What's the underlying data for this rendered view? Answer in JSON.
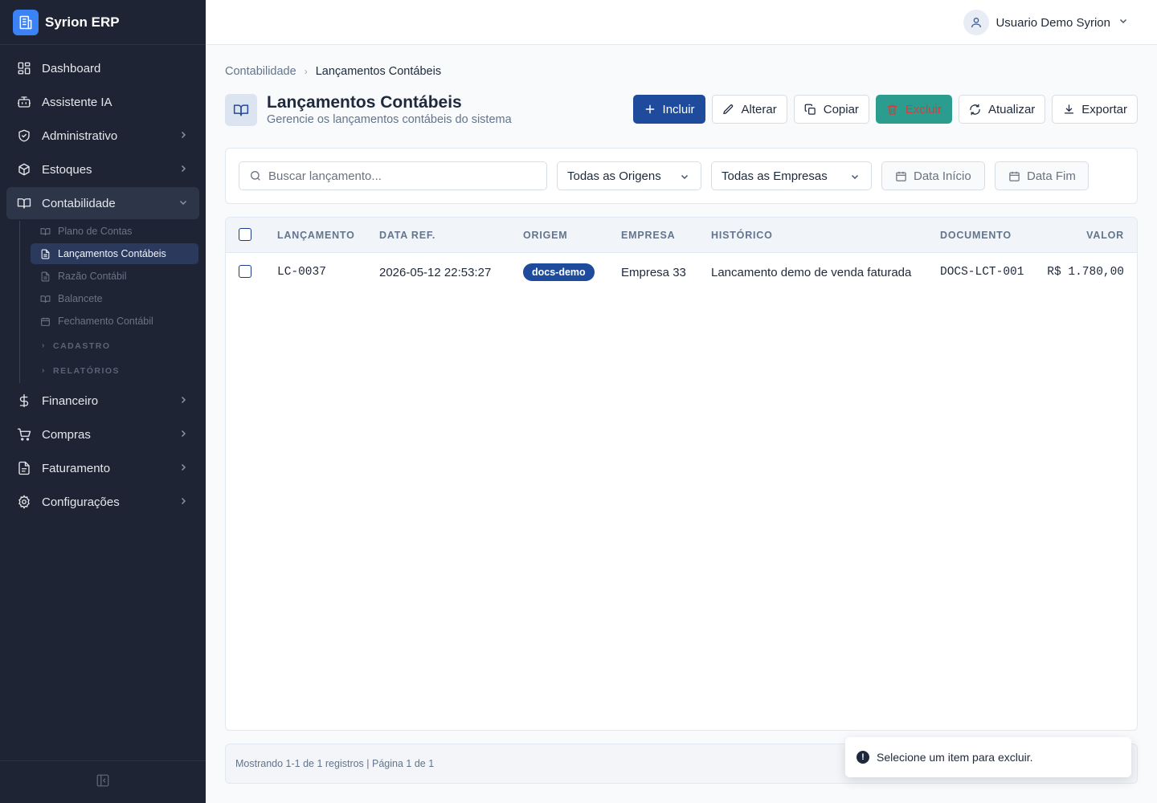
{
  "app": {
    "name": "Syrion ERP"
  },
  "sidebar": {
    "items": [
      {
        "label": "Dashboard"
      },
      {
        "label": "Assistente IA"
      },
      {
        "label": "Administrativo"
      },
      {
        "label": "Estoques"
      },
      {
        "label": "Contabilidade"
      },
      {
        "label": "Financeiro"
      },
      {
        "label": "Compras"
      },
      {
        "label": "Faturamento"
      },
      {
        "label": "Configurações"
      }
    ],
    "contabilidade_sub": [
      {
        "label": "Plano de Contas"
      },
      {
        "label": "Lançamentos Contábeis"
      },
      {
        "label": "Razão Contábil"
      },
      {
        "label": "Balancete"
      },
      {
        "label": "Fechamento Contábil"
      }
    ],
    "groups": [
      {
        "label": "CADASTRO"
      },
      {
        "label": "RELATÓRIOS"
      }
    ]
  },
  "topbar": {
    "user_name": "Usuario Demo Syrion"
  },
  "breadcrumb": {
    "parent": "Contabilidade",
    "current": "Lançamentos Contábeis"
  },
  "page": {
    "title": "Lançamentos Contábeis",
    "subtitle": "Gerencie os lançamentos contábeis do sistema"
  },
  "toolbar": {
    "incluir": "Incluir",
    "alterar": "Alterar",
    "copiar": "Copiar",
    "excluir": "Excluir",
    "atualizar": "Atualizar",
    "exportar": "Exportar"
  },
  "filters": {
    "search_placeholder": "Buscar lançamento...",
    "origem_selected": "Todas as Origens",
    "empresa_selected": "Todas as Empresas",
    "data_inicio": "Data Início",
    "data_fim": "Data Fim"
  },
  "table": {
    "columns": [
      "LANÇAMENTO",
      "DATA REF.",
      "ORIGEM",
      "EMPRESA",
      "HISTÓRICO",
      "DOCUMENTO",
      "VALOR"
    ],
    "rows": [
      {
        "lancamento": "LC-0037",
        "data_ref": "2026-05-12 22:53:27",
        "origem": "docs-demo",
        "empresa": "Empresa 33",
        "historico": "Lancamento demo de venda faturada",
        "documento": "DOCS-LCT-001",
        "valor": "R$ 1.780,00"
      }
    ]
  },
  "footer": {
    "status": "Mostrando 1-1 de 1 registros | Página 1 de 1"
  },
  "toast": {
    "message": "Selecione um item para excluir."
  },
  "colors": {
    "sidebar_bg": "#1e2433",
    "primary": "#1e4b9b",
    "danger_bg": "#2a9d8f",
    "danger_text": "#dc3a3a"
  }
}
